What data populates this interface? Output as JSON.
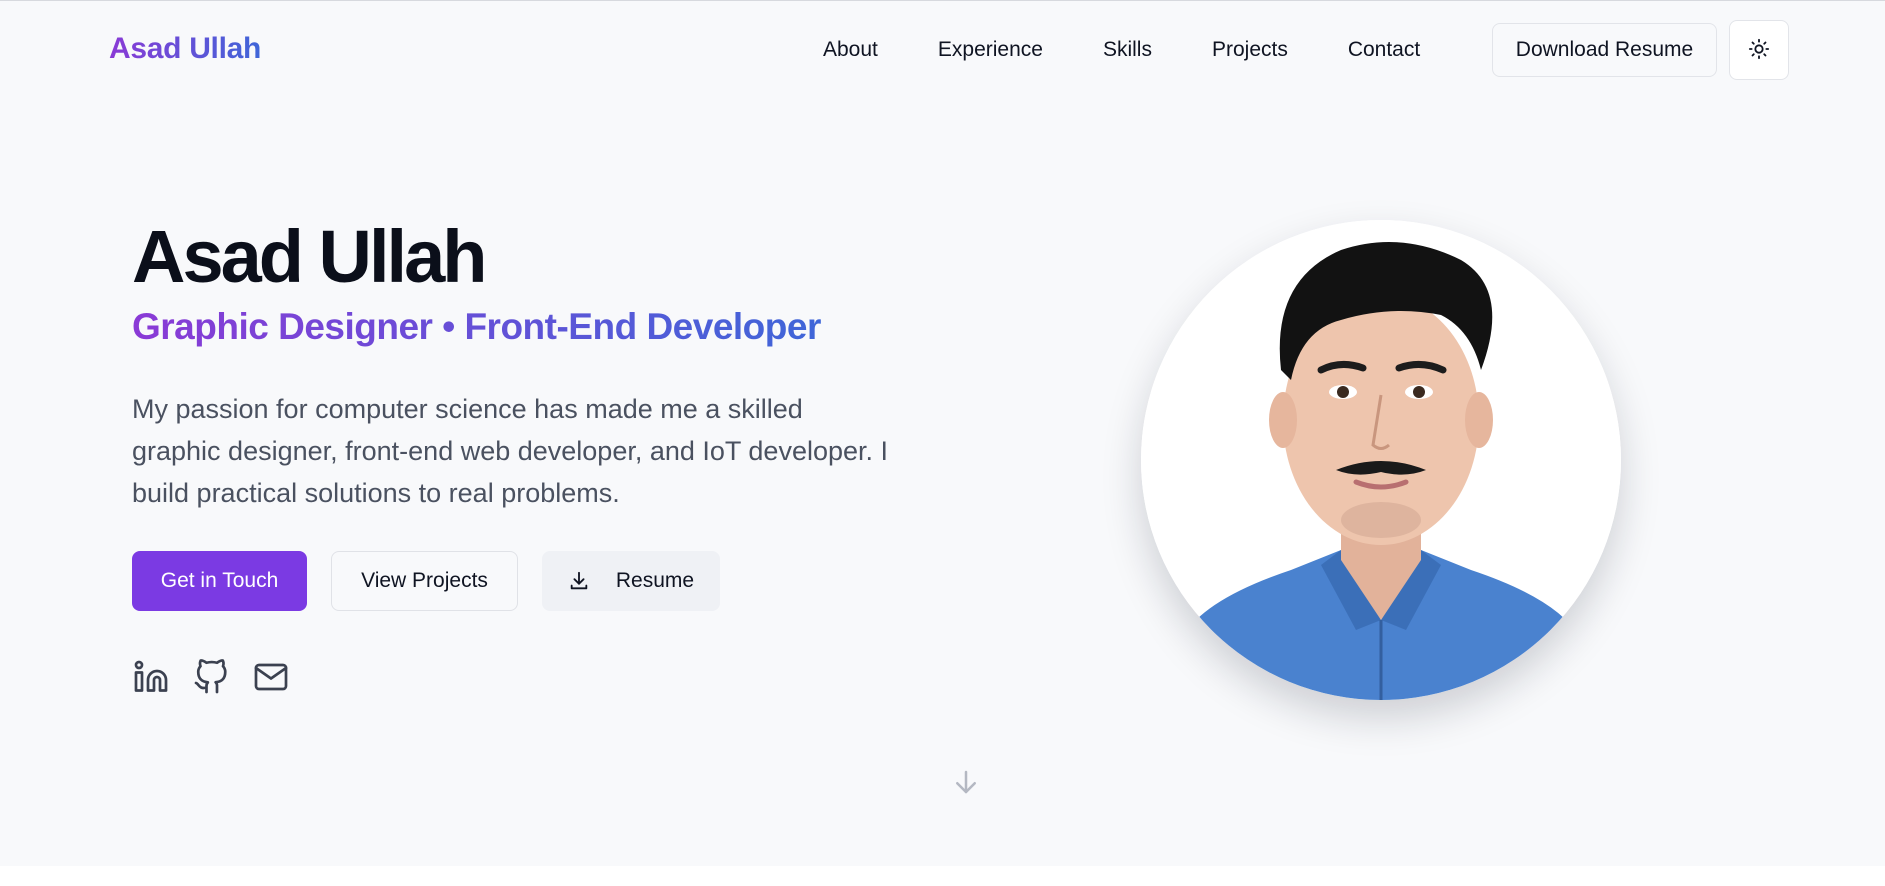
{
  "nav": {
    "logo": "Asad Ullah",
    "links": [
      {
        "label": "About"
      },
      {
        "label": "Experience"
      },
      {
        "label": "Skills"
      },
      {
        "label": "Projects"
      },
      {
        "label": "Contact"
      }
    ],
    "download_label": "Download Resume",
    "theme_icon": "sun-icon"
  },
  "hero": {
    "name": "Asad Ullah",
    "role": "Graphic Designer • Front-End Developer",
    "bio": "My passion for computer science has made me a skilled graphic designer, front-end web developer, and IoT developer. I build practical solutions to real problems.",
    "cta_primary": "Get in Touch",
    "cta_secondary": "View Projects",
    "cta_resume": "Resume",
    "social_icons": [
      "linkedin-icon",
      "github-icon",
      "mail-icon"
    ],
    "portrait_icon": "profile-photo",
    "scroll_icon": "arrow-down-icon"
  },
  "colors": {
    "background": "#f8f9fb",
    "accent": "#7b3ae3",
    "gradient_start": "#8a3ad6",
    "gradient_end": "#3f66d8",
    "heading": "#0b0f1a",
    "body_text": "#4a5160"
  }
}
